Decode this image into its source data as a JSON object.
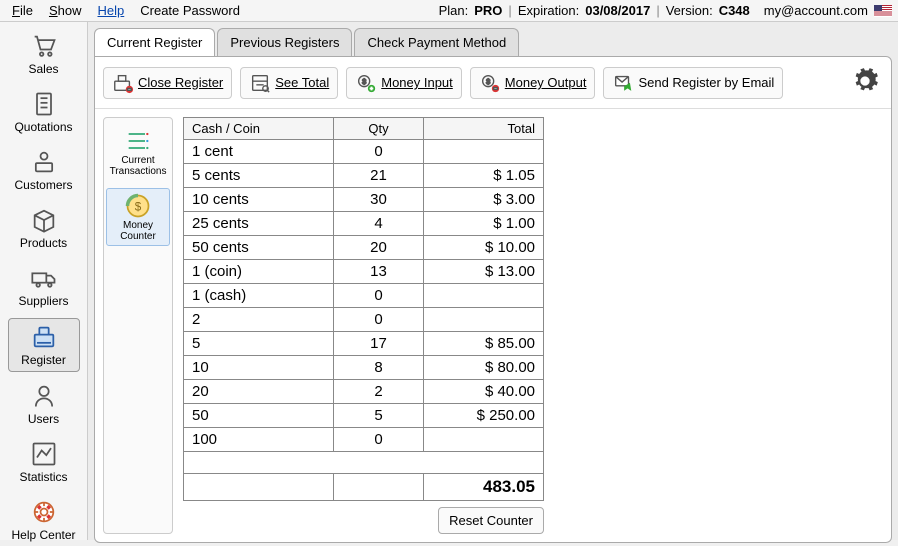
{
  "menu": {
    "file": "File",
    "show": "Show",
    "help": "Help",
    "create_password": "Create Password"
  },
  "header": {
    "plan_label": "Plan:",
    "plan_value": "PRO",
    "expiration_label": "Expiration:",
    "expiration_value": "03/08/2017",
    "version_label": "Version:",
    "version_value": "C348",
    "account": "my@account.com"
  },
  "leftnav": {
    "items": [
      {
        "key": "sales",
        "label": "Sales"
      },
      {
        "key": "quotations",
        "label": "Quotations"
      },
      {
        "key": "customers",
        "label": "Customers"
      },
      {
        "key": "products",
        "label": "Products"
      },
      {
        "key": "suppliers",
        "label": "Suppliers"
      },
      {
        "key": "register",
        "label": "Register"
      },
      {
        "key": "users",
        "label": "Users"
      },
      {
        "key": "statistics",
        "label": "Statistics"
      },
      {
        "key": "help_center",
        "label": "Help Center"
      }
    ],
    "selected": "register"
  },
  "tabs": {
    "items": [
      {
        "key": "current",
        "label": "Current Register"
      },
      {
        "key": "previous",
        "label": "Previous Registers"
      },
      {
        "key": "check",
        "label": "Check Payment Method"
      }
    ],
    "active": "current"
  },
  "toolbar": {
    "close_register": "Close Register",
    "see_total": "See Total",
    "money_input": "Money Input",
    "money_output": "Money Output",
    "send_email": "Send Register by Email"
  },
  "subside": {
    "items": [
      {
        "key": "current_tx",
        "label": "Current Transactions"
      },
      {
        "key": "money_counter",
        "label": "Money Counter"
      }
    ],
    "selected": "money_counter"
  },
  "money_table": {
    "headers": {
      "denom": "Cash / Coin",
      "qty": "Qty",
      "total": "Total"
    },
    "rows": [
      {
        "denom": "1 cent",
        "qty": "0",
        "total": ""
      },
      {
        "denom": "5 cents",
        "qty": "21",
        "total": "$ 1.05"
      },
      {
        "denom": "10 cents",
        "qty": "30",
        "total": "$ 3.00"
      },
      {
        "denom": "25 cents",
        "qty": "4",
        "total": "$ 1.00"
      },
      {
        "denom": "50 cents",
        "qty": "20",
        "total": "$ 10.00"
      },
      {
        "denom": "1 (coin)",
        "qty": "13",
        "total": "$ 13.00"
      },
      {
        "denom": "1 (cash)",
        "qty": "0",
        "total": ""
      },
      {
        "denom": "2",
        "qty": "0",
        "total": ""
      },
      {
        "denom": "5",
        "qty": "17",
        "total": "$ 85.00"
      },
      {
        "denom": "10",
        "qty": "8",
        "total": "$ 80.00"
      },
      {
        "denom": "20",
        "qty": "2",
        "total": "$ 40.00"
      },
      {
        "denom": "50",
        "qty": "5",
        "total": "$ 250.00"
      },
      {
        "denom": "100",
        "qty": "0",
        "total": ""
      }
    ],
    "grand_total": "483.05",
    "reset_button": "Reset Counter"
  }
}
